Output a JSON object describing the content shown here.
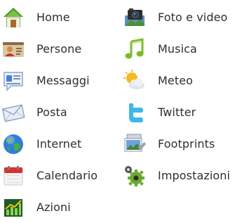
{
  "menu": {
    "left_items": [
      {
        "label": "Home",
        "icon": "home-icon"
      },
      {
        "label": "Persone",
        "icon": "contact-card-icon"
      },
      {
        "label": "Messaggi",
        "icon": "message-bubble-icon"
      },
      {
        "label": "Posta",
        "icon": "envelope-icon"
      },
      {
        "label": "Internet",
        "icon": "globe-icon"
      },
      {
        "label": "Calendario",
        "icon": "calendar-icon"
      },
      {
        "label": "Azioni",
        "icon": "stock-chart-icon"
      }
    ],
    "right_items": [
      {
        "label": "Foto e video",
        "icon": "camera-icon"
      },
      {
        "label": "Musica",
        "icon": "music-note-icon"
      },
      {
        "label": "Meteo",
        "icon": "weather-icon"
      },
      {
        "label": "Twitter",
        "icon": "twitter-icon"
      },
      {
        "label": "Footprints",
        "icon": "footprints-photo-icon"
      },
      {
        "label": "Impostazioni",
        "icon": "gear-icon"
      }
    ]
  }
}
